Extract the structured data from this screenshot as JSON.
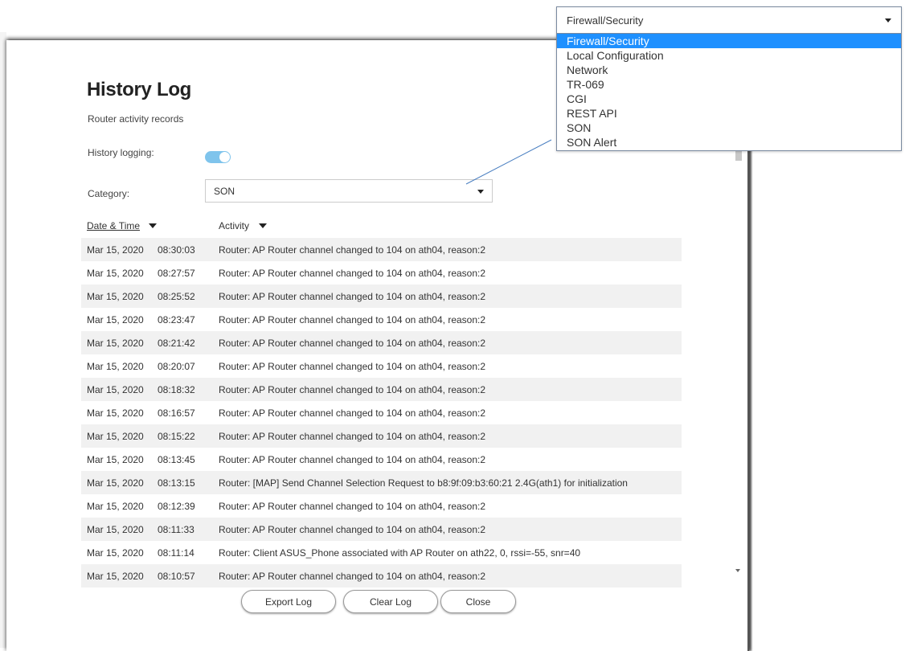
{
  "dialog": {
    "title": "History Log",
    "subtitle": "Router activity records",
    "logging_label": "History logging:",
    "logging_enabled": true,
    "category_label": "Category:",
    "category_value": "SON",
    "columns": {
      "date": "Date & Time",
      "activity": "Activity"
    },
    "rows": [
      {
        "date": "Mar 15, 2020",
        "time": "08:30:03",
        "activity": "Router: AP Router channel changed to 104 on ath04, reason:2"
      },
      {
        "date": "Mar 15, 2020",
        "time": "08:27:57",
        "activity": "Router: AP Router channel changed to 104 on ath04, reason:2"
      },
      {
        "date": "Mar 15, 2020",
        "time": "08:25:52",
        "activity": "Router: AP Router channel changed to 104 on ath04, reason:2"
      },
      {
        "date": "Mar 15, 2020",
        "time": "08:23:47",
        "activity": "Router: AP Router channel changed to 104 on ath04, reason:2"
      },
      {
        "date": "Mar 15, 2020",
        "time": "08:21:42",
        "activity": "Router: AP Router channel changed to 104 on ath04, reason:2"
      },
      {
        "date": "Mar 15, 2020",
        "time": "08:20:07",
        "activity": "Router: AP Router channel changed to 104 on ath04, reason:2"
      },
      {
        "date": "Mar 15, 2020",
        "time": "08:18:32",
        "activity": "Router: AP Router channel changed to 104 on ath04, reason:2"
      },
      {
        "date": "Mar 15, 2020",
        "time": "08:16:57",
        "activity": "Router: AP Router channel changed to 104 on ath04, reason:2"
      },
      {
        "date": "Mar 15, 2020",
        "time": "08:15:22",
        "activity": "Router: AP Router channel changed to 104 on ath04, reason:2"
      },
      {
        "date": "Mar 15, 2020",
        "time": "08:13:45",
        "activity": "Router: AP Router channel changed to 104 on ath04, reason:2"
      },
      {
        "date": "Mar 15, 2020",
        "time": "08:13:15",
        "activity": "Router: [MAP] Send Channel Selection Request to b8:9f:09:b3:60:21 2.4G(ath1) for initialization"
      },
      {
        "date": "Mar 15, 2020",
        "time": "08:12:39",
        "activity": "Router: AP Router channel changed to 104 on ath04, reason:2"
      },
      {
        "date": "Mar 15, 2020",
        "time": "08:11:33",
        "activity": "Router: AP Router channel changed to 104 on ath04, reason:2"
      },
      {
        "date": "Mar 15, 2020",
        "time": "08:11:14",
        "activity": "Router: Client ASUS_Phone associated with AP Router on ath22, 0, rssi=-55, snr=40"
      },
      {
        "date": "Mar 15, 2020",
        "time": "08:10:57",
        "activity": "Router: AP Router channel changed to 104 on ath04, reason:2"
      }
    ],
    "buttons": {
      "export": "Export Log",
      "clear": "Clear Log",
      "close": "Close"
    }
  },
  "category_dropdown": {
    "selected": "Firewall/Security",
    "options": [
      "Firewall/Security",
      "Local Configuration",
      "Network",
      "TR-069",
      "CGI",
      "REST API",
      "SON",
      "SON Alert"
    ],
    "highlighted_index": 0
  },
  "colors": {
    "toggle_on": "#7fc4ec",
    "highlight": "#1e90ff",
    "row_shade": "#f1f1f1",
    "connector": "#4a7fc1"
  }
}
